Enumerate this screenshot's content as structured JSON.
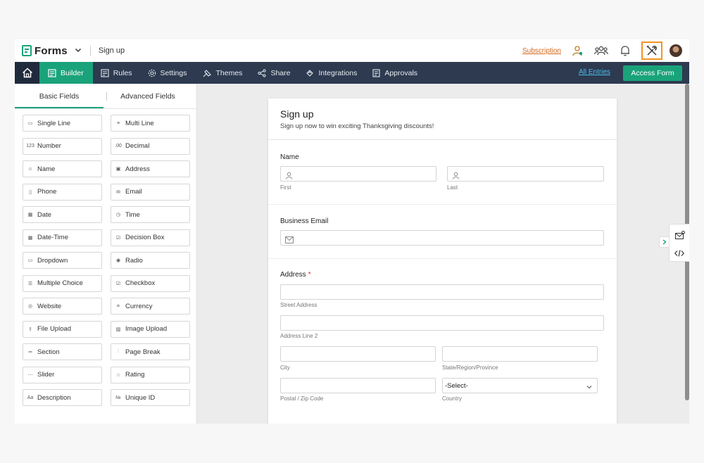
{
  "app": {
    "name": "Forms",
    "form_name": "Sign up"
  },
  "topbar": {
    "subscription": "Subscription"
  },
  "nav": {
    "items": [
      {
        "label": "Builder",
        "icon": "builder-icon"
      },
      {
        "label": "Rules",
        "icon": "rules-icon"
      },
      {
        "label": "Settings",
        "icon": "gear-icon"
      },
      {
        "label": "Themes",
        "icon": "palette-icon"
      },
      {
        "label": "Share",
        "icon": "share-icon"
      },
      {
        "label": "Integrations",
        "icon": "integrations-icon"
      },
      {
        "label": "Approvals",
        "icon": "approvals-icon"
      }
    ],
    "all_entries": "All Entries",
    "access_form": "Access Form"
  },
  "fields_panel": {
    "tabs": [
      "Basic Fields",
      "Advanced Fields"
    ],
    "fields": [
      {
        "label": "Single Line",
        "icon": "single-line-icon"
      },
      {
        "label": "Multi Line",
        "icon": "multi-line-icon"
      },
      {
        "label": "Number",
        "icon": "number-icon"
      },
      {
        "label": "Decimal",
        "icon": "decimal-icon"
      },
      {
        "label": "Name",
        "icon": "person-icon"
      },
      {
        "label": "Address",
        "icon": "address-icon"
      },
      {
        "label": "Phone",
        "icon": "phone-icon"
      },
      {
        "label": "Email",
        "icon": "mail-icon"
      },
      {
        "label": "Date",
        "icon": "calendar-icon"
      },
      {
        "label": "Time",
        "icon": "clock-icon"
      },
      {
        "label": "Date-Time",
        "icon": "date-time-icon"
      },
      {
        "label": "Decision Box",
        "icon": "checkbox-icon"
      },
      {
        "label": "Dropdown",
        "icon": "dropdown-icon"
      },
      {
        "label": "Radio",
        "icon": "radio-icon"
      },
      {
        "label": "Multiple Choice",
        "icon": "multiple-choice-icon"
      },
      {
        "label": "Checkbox",
        "icon": "checklist-icon"
      },
      {
        "label": "Website",
        "icon": "globe-icon"
      },
      {
        "label": "Currency",
        "icon": "currency-icon"
      },
      {
        "label": "File Upload",
        "icon": "file-upload-icon"
      },
      {
        "label": "Image Upload",
        "icon": "image-icon"
      },
      {
        "label": "Section",
        "icon": "section-icon"
      },
      {
        "label": "Page Break",
        "icon": "page-break-icon"
      },
      {
        "label": "Slider",
        "icon": "slider-icon"
      },
      {
        "label": "Rating",
        "icon": "star-icon"
      },
      {
        "label": "Description",
        "icon": "description-icon"
      },
      {
        "label": "Unique ID",
        "icon": "unique-id-icon"
      }
    ]
  },
  "form": {
    "title": "Sign up",
    "subtitle": "Sign up now to win exciting Thanksgiving discounts!",
    "name_label": "Name",
    "first_hint": "First",
    "last_hint": "Last",
    "email_label": "Business Email",
    "address_label": "Address",
    "required_mark": "*",
    "street_hint": "Street Address",
    "line2_hint": "Address Line 2",
    "city_hint": "City",
    "state_hint": "State/Region/Province",
    "zip_hint": "Postal / Zip Code",
    "country_hint": "Country",
    "country_value": "-Select-"
  },
  "colors": {
    "accent": "#1aa37a",
    "nav_bg": "#2d3a50",
    "highlight": "#f39422",
    "subscription": "#d4681b"
  }
}
